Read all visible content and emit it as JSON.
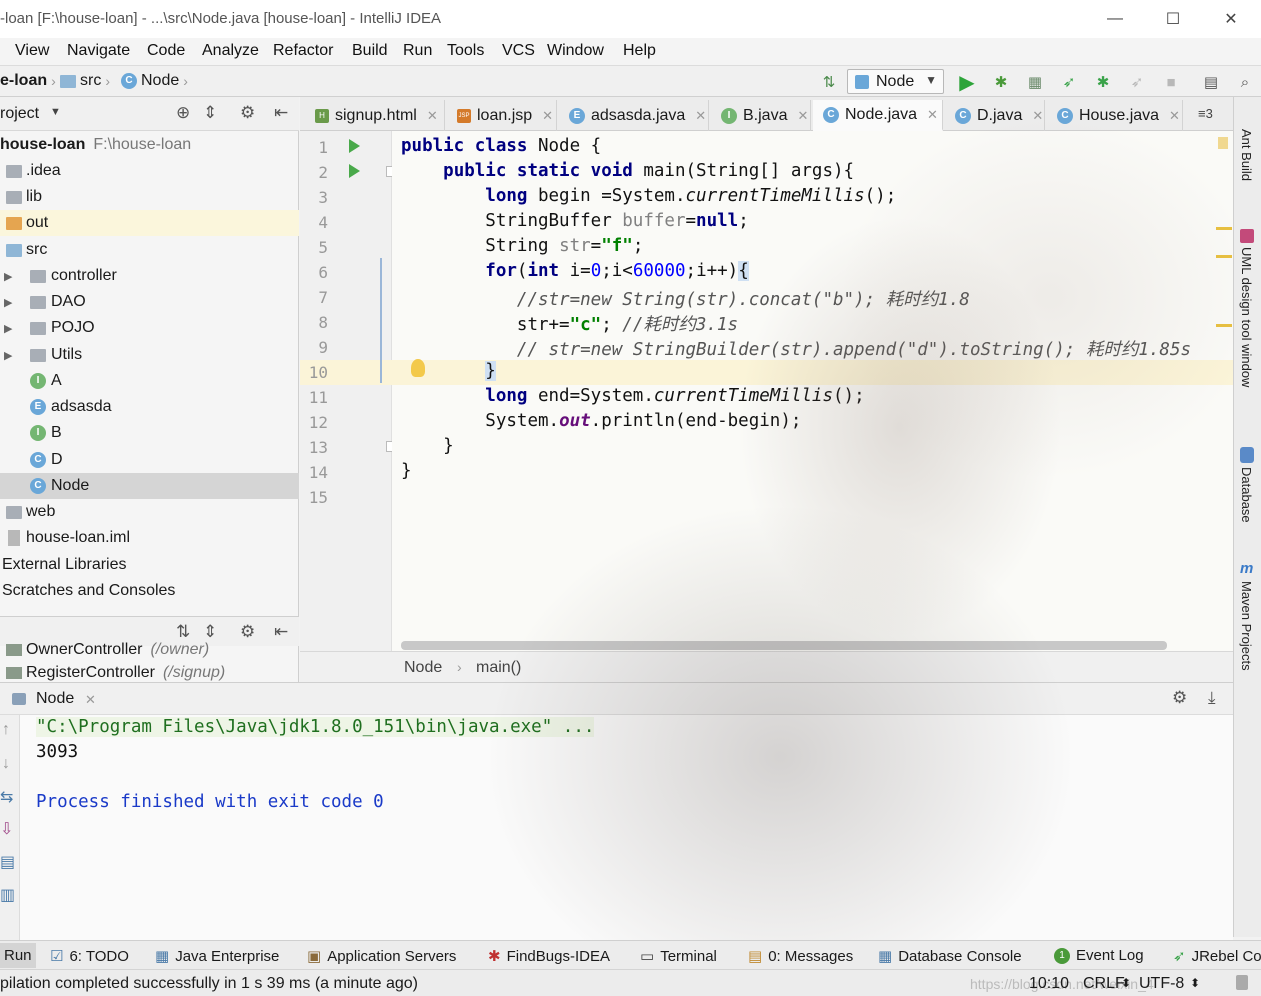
{
  "window": {
    "title": "-loan [F:\\house-loan] - ...\\src\\Node.java [house-loan] - IntelliJ IDEA",
    "minimize": "—",
    "maximize": "☐",
    "close": "✕"
  },
  "menu": [
    "View",
    "Navigate",
    "Code",
    "Analyze",
    "Refactor",
    "Build",
    "Run",
    "Tools",
    "VCS",
    "Window",
    "Help"
  ],
  "breadcrumb": [
    "e-loan",
    "src",
    "Node"
  ],
  "run_config": "Node",
  "project_panel": {
    "title": "roject",
    "tree": [
      {
        "label": "house-loan",
        "extra": "F:\\house-loan"
      },
      {
        "label": ".idea"
      },
      {
        "label": "lib"
      },
      {
        "label": "out"
      },
      {
        "label": "src"
      },
      {
        "label": "controller"
      },
      {
        "label": "DAO"
      },
      {
        "label": "POJO"
      },
      {
        "label": "Utils"
      },
      {
        "label": "A",
        "icon": "I"
      },
      {
        "label": "adsasda",
        "icon": "E"
      },
      {
        "label": "B",
        "icon": "I"
      },
      {
        "label": "D",
        "icon": "C"
      },
      {
        "label": "Node",
        "icon": "C"
      },
      {
        "label": "web"
      },
      {
        "label": "house-loan.iml"
      },
      {
        "label": "External Libraries"
      },
      {
        "label": "Scratches and Consoles"
      }
    ],
    "structure": [
      {
        "label": "OwnerController",
        "extra": "(/owner)"
      },
      {
        "label": "RegisterController",
        "extra": "(/signup)"
      }
    ]
  },
  "tabs": [
    {
      "label": "signup.html",
      "icon": "H"
    },
    {
      "label": "loan.jsp",
      "icon": "JSP"
    },
    {
      "label": "adsasda.java",
      "icon": "E"
    },
    {
      "label": "B.java",
      "icon": "I"
    },
    {
      "label": "Node.java",
      "icon": "C",
      "active": true
    },
    {
      "label": "D.java",
      "icon": "C"
    },
    {
      "label": "House.java",
      "icon": "C"
    }
  ],
  "tabs_overflow": "≡3",
  "line_numbers": [
    "1",
    "2",
    "3",
    "4",
    "5",
    "6",
    "7",
    "8",
    "9",
    "10",
    "11",
    "12",
    "13",
    "14",
    "15"
  ],
  "code": {
    "l1_kw": "public class ",
    "l1_rest": "Node {",
    "l2_kw": "public static void ",
    "l2_rest": "main(String[] args){",
    "l3_kw": "long ",
    "l3_a": "begin =System.",
    "l3_b": "currentTimeMillis",
    "l3_c": "();",
    "l4_a": "StringBuffer ",
    "l4_b": "buffer",
    "l4_c": "=",
    "l4_d": "null",
    "l4_e": ";",
    "l5_a": "String ",
    "l5_b": "str",
    "l5_c": "=",
    "l5_d": "\"f\"",
    "l5_e": ";",
    "l6_a": "for",
    "l6_b": "(",
    "l6_c": "int ",
    "l6_d": "i=",
    "l6_e": "0",
    "l6_f": ";i<",
    "l6_g": "60000",
    "l6_h": ";i++)",
    "l6_i": "{",
    "l7": "//str=new String(str).concat(\"b\"); 耗时约1.8",
    "l8_a": "str+=",
    "l8_b": "\"c\"",
    "l8_c": "; ",
    "l8_d": "//耗时约3.1s",
    "l9": "// str=new StringBuilder(str).append(\"d\").toString(); 耗时约1.85s",
    "l10": "}",
    "l11_kw": "long ",
    "l11_a": "end=System.",
    "l11_b": "currentTimeMillis",
    "l11_c": "();",
    "l12_a": "System.",
    "l12_b": "out",
    "l12_c": ".println(end-begin);",
    "l13": "}",
    "l14": "}"
  },
  "editor_breadcrumb": [
    "Node",
    "main()"
  ],
  "right_tools": [
    "Ant Build",
    "UML design tool window",
    "Database",
    "Maven Projects"
  ],
  "run_panel": {
    "tab": "Node",
    "output": [
      "\"C:\\Program Files\\Java\\jdk1.8.0_151\\bin\\java.exe\" ...",
      "3093",
      "",
      "Process finished with exit code 0"
    ]
  },
  "bottom_tabs": [
    {
      "label": "Run"
    },
    {
      "label": "6: TODO"
    },
    {
      "label": "Java Enterprise"
    },
    {
      "label": "Application Servers"
    },
    {
      "label": "FindBugs-IDEA"
    },
    {
      "label": "Terminal"
    },
    {
      "label": "0: Messages"
    },
    {
      "label": "Database Console"
    },
    {
      "label": "Event Log",
      "badge": "1"
    },
    {
      "label": "JRebel Co"
    }
  ],
  "status": {
    "message": "pilation completed successfully in 1 s 39 ms (a minute ago)",
    "position": "10:10",
    "line_sep": "CRLF",
    "encoding": "UTF-8",
    "watermark": "https://blog.csdn.net/weixin_4"
  },
  "colors": {
    "keyword": "#000080",
    "string": "#008000",
    "number": "#0000ff",
    "run_green": "#49a94a",
    "caret_line": "#fbf4d8"
  }
}
